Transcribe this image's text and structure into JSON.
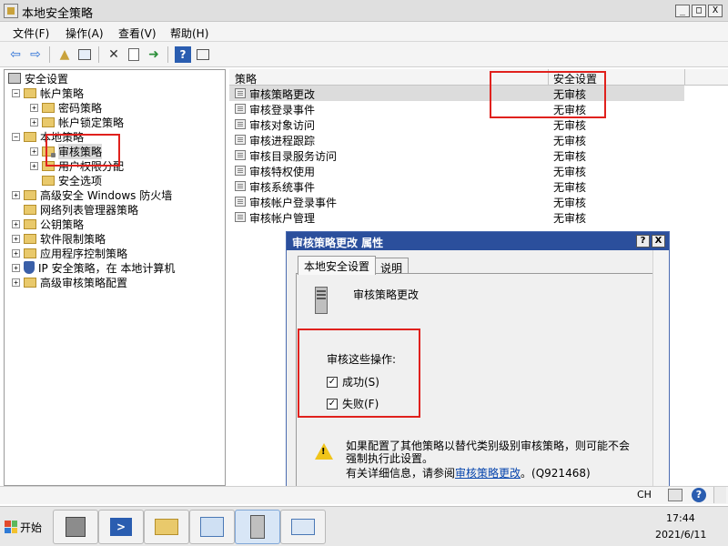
{
  "window": {
    "title": "本地安全策略",
    "minimize": "_",
    "maximize": "□",
    "close": "X"
  },
  "menubar": {
    "items": [
      "文件(F)",
      "操作(A)",
      "查看(V)",
      "帮助(H)"
    ]
  },
  "toolbar": {
    "icons": [
      "back-icon",
      "forward-icon",
      "up-folder-icon",
      "show-tree-icon",
      "delete-icon",
      "properties-icon",
      "export-icon",
      "help-icon",
      "view-icon"
    ]
  },
  "tree": {
    "root": "安全设置",
    "account_policy": "帐户策略",
    "password_policy": "密码策略",
    "lockout_policy": "帐户锁定策略",
    "local_policy": "本地策略",
    "audit_policy": "审核策略",
    "user_rights": "用户权限分配",
    "security_options": "安全选项",
    "firewall": "高级安全 Windows 防火墙",
    "network_list": "网络列表管理器策略",
    "public_key": "公钥策略",
    "software_restriction": "软件限制策略",
    "app_control": "应用程序控制策略",
    "ip_security": "IP 安全策略，在 本地计算机",
    "advanced_audit": "高级审核策略配置"
  },
  "list": {
    "col_policy": "策略",
    "col_setting": "安全设置",
    "rows": [
      {
        "name": "审核策略更改",
        "value": "无审核"
      },
      {
        "name": "审核登录事件",
        "value": "无审核"
      },
      {
        "name": "审核对象访问",
        "value": "无审核"
      },
      {
        "name": "审核进程跟踪",
        "value": "无审核"
      },
      {
        "name": "审核目录服务访问",
        "value": "无审核"
      },
      {
        "name": "审核特权使用",
        "value": "无审核"
      },
      {
        "name": "审核系统事件",
        "value": "无审核"
      },
      {
        "name": "审核帐户登录事件",
        "value": "无审核"
      },
      {
        "name": "审核帐户管理",
        "value": "无审核"
      }
    ]
  },
  "dialog": {
    "title": "审核策略更改 属性",
    "help_btn": "?",
    "close_btn": "X",
    "tab_local": "本地安全设置",
    "tab_explain": "说明",
    "policy_name": "审核策略更改",
    "audit_label": "审核这些操作:",
    "success_label": "成功(S)",
    "failure_label": "失败(F)",
    "success_checked": true,
    "failure_checked": true,
    "checkmark": "✓",
    "warning_text": "如果配置了其他策略以替代类别级别审核策略，则可能不会强制执行此设置。",
    "more_info_prefix": "有关详细信息，请参阅",
    "more_info_link": "审核策略更改",
    "more_info_suffix": "。(Q921468)"
  },
  "taskbar": {
    "start_label": "开始",
    "apps": [
      "server-manager-icon",
      "powershell-icon",
      "explorer-icon",
      "control-panel-icon",
      "local-security-policy-icon",
      "network-icon"
    ],
    "lang": "CH",
    "time": "17:44",
    "date": "2021/6/11"
  },
  "colors": {
    "highlight_box": "#e0211d",
    "dialog_title_bg": "#2b4f9c",
    "folder": "#e9c96b"
  }
}
